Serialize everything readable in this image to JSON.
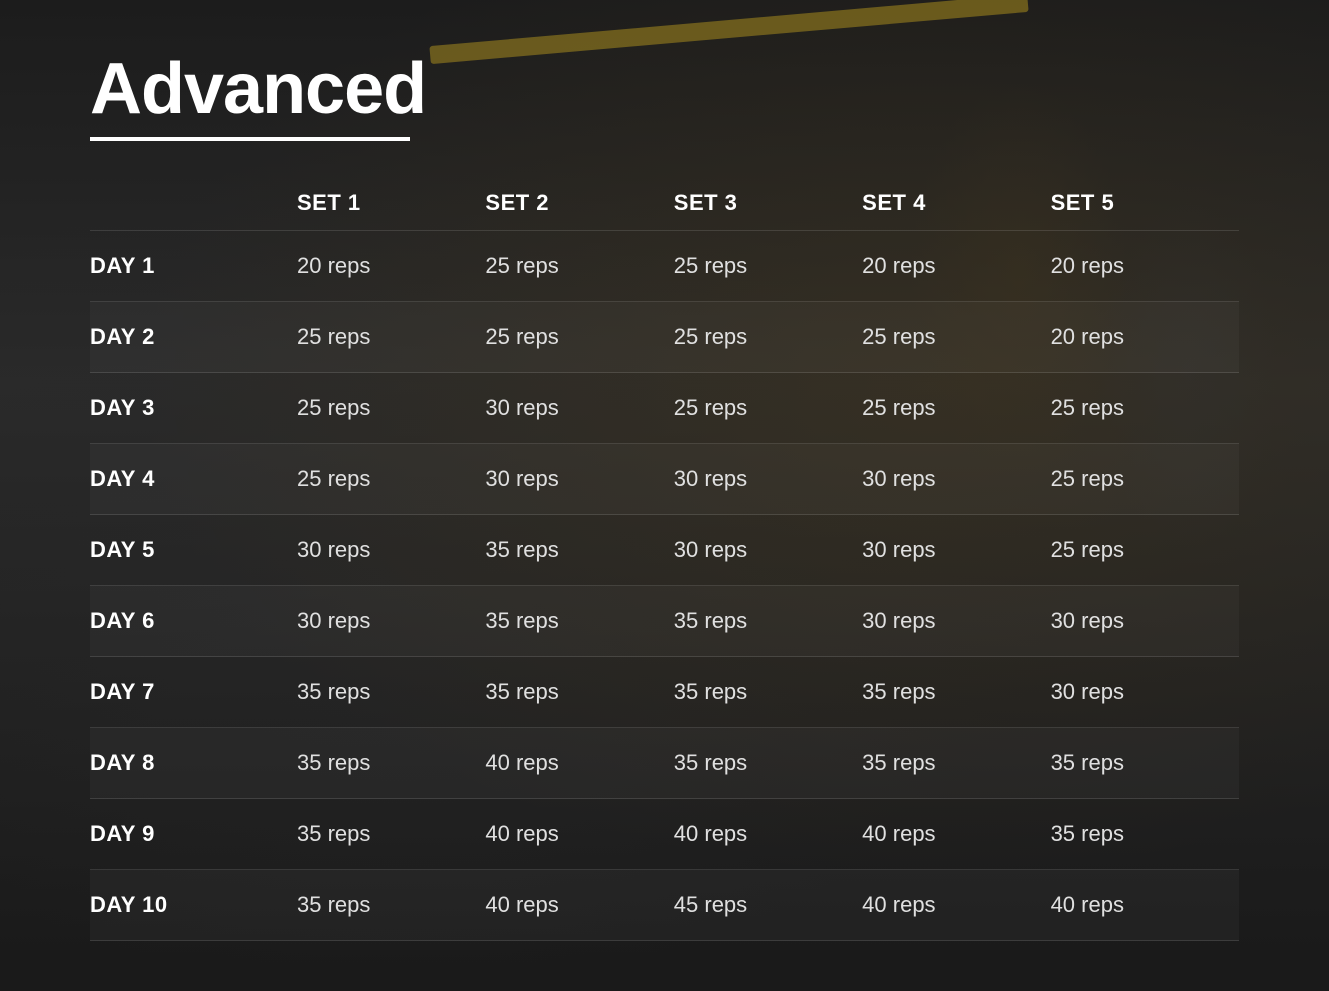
{
  "title": "Advanced",
  "columns": {
    "day_header": "",
    "set1": "SET 1",
    "set2": "SET 2",
    "set3": "SET 3",
    "set4": "SET 4",
    "set5": "SET 5"
  },
  "rows": [
    {
      "day": "DAY 1",
      "set1": "20 reps",
      "set2": "25 reps",
      "set3": "25 reps",
      "set4": "20 reps",
      "set5": "20 reps"
    },
    {
      "day": "DAY 2",
      "set1": "25 reps",
      "set2": "25 reps",
      "set3": "25 reps",
      "set4": "25 reps",
      "set5": "20 reps"
    },
    {
      "day": "DAY 3",
      "set1": "25 reps",
      "set2": "30 reps",
      "set3": "25 reps",
      "set4": "25 reps",
      "set5": "25 reps"
    },
    {
      "day": "DAY 4",
      "set1": "25 reps",
      "set2": "30 reps",
      "set3": "30 reps",
      "set4": "30 reps",
      "set5": "25 reps"
    },
    {
      "day": "DAY 5",
      "set1": "30 reps",
      "set2": "35 reps",
      "set3": "30 reps",
      "set4": "30 reps",
      "set5": "25 reps"
    },
    {
      "day": "DAY 6",
      "set1": "30 reps",
      "set2": "35 reps",
      "set3": "35 reps",
      "set4": "30 reps",
      "set5": "30 reps"
    },
    {
      "day": "DAY 7",
      "set1": "35 reps",
      "set2": "35 reps",
      "set3": "35 reps",
      "set4": "35 reps",
      "set5": "30 reps"
    },
    {
      "day": "DAY 8",
      "set1": "35 reps",
      "set2": "40 reps",
      "set3": "35 reps",
      "set4": "35 reps",
      "set5": "35 reps"
    },
    {
      "day": "DAY 9",
      "set1": "35 reps",
      "set2": "40 reps",
      "set3": "40 reps",
      "set4": "40 reps",
      "set5": "35 reps"
    },
    {
      "day": "DAY 10",
      "set1": "35 reps",
      "set2": "40 reps",
      "set3": "45 reps",
      "set4": "40 reps",
      "set5": "40 reps"
    }
  ]
}
